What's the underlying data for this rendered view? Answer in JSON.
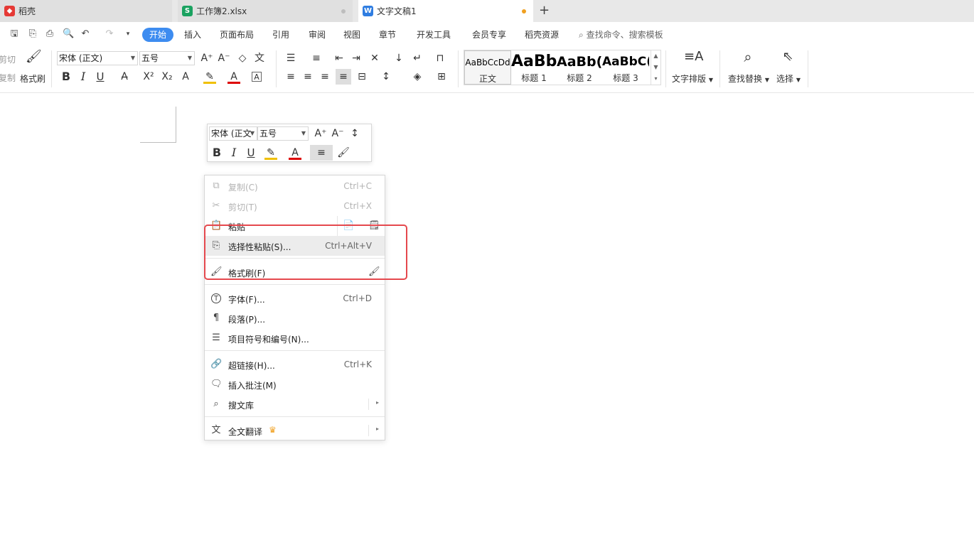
{
  "tabs": [
    {
      "label": "稻壳",
      "icon": "daoke-logo-icon",
      "color": "#e53935"
    },
    {
      "label": "工作簿2.xlsx",
      "icon": "spreadsheet-icon",
      "color": "#1aa260"
    },
    {
      "label": "文字文稿1",
      "icon": "writer-doc-icon",
      "color": "#2f7de1"
    }
  ],
  "menu": {
    "items": [
      "开始",
      "插入",
      "页面布局",
      "引用",
      "审阅",
      "视图",
      "章节",
      "开发工具",
      "会员专享",
      "稻壳资源"
    ],
    "active": "开始",
    "search": "查找命令、搜索模板"
  },
  "ribbon": {
    "cut": "剪切",
    "copy": "复制",
    "format_painter": "格式刷",
    "font_name": "宋体 (正文)",
    "font_size": "五号",
    "styles": [
      {
        "sample": "AaBbCcDd",
        "label": "正文"
      },
      {
        "sample": "AaBb",
        "label": "标题 1"
      },
      {
        "sample": "AaBb(",
        "label": "标题 2"
      },
      {
        "sample": "AaBbC(",
        "label": "标题 3"
      }
    ],
    "text_layout": "文字排版",
    "find_replace": "查找替换",
    "select": "选择"
  },
  "mini_toolbar": {
    "font_name": "宋体 (正文",
    "font_size": "五号"
  },
  "context_menu": {
    "copy": {
      "label": "复制(C)",
      "shortcut": "Ctrl+C"
    },
    "cut": {
      "label": "剪切(T)",
      "shortcut": "Ctrl+X"
    },
    "paste": {
      "label": "粘贴"
    },
    "paste_special": {
      "label": "选择性粘贴(S)...",
      "shortcut": "Ctrl+Alt+V"
    },
    "format_painter": {
      "label": "格式刷(F)"
    },
    "font": {
      "label": "字体(F)...",
      "shortcut": "Ctrl+D"
    },
    "paragraph": {
      "label": "段落(P)..."
    },
    "bullets": {
      "label": "项目符号和编号(N)..."
    },
    "hyperlink": {
      "label": "超链接(H)...",
      "shortcut": "Ctrl+K"
    },
    "comment": {
      "label": "插入批注(M)"
    },
    "search_library": {
      "label": "搜文库"
    },
    "translate": {
      "label": "全文翻译"
    }
  },
  "colors": {
    "accent": "#3d8cf0",
    "highlight_border": "#e5484d",
    "unsaved_dot": "#f0a020"
  }
}
